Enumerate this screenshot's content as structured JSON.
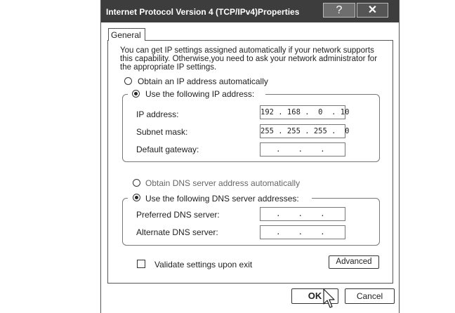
{
  "window": {
    "title": "Internet Protocol Version 4 (TCP/IPv4)Properties",
    "help_label": "?",
    "close_label": "✕"
  },
  "tab_general": "General",
  "intro_lines": [
    "You can get IP settings assigned automatically if your network supports",
    "this capability. Otherwise,you need to ask your network administrator for",
    "the appropriate IP settings."
  ],
  "ip_mode": {
    "auto_label": "Obtain an IP address automatically",
    "manual_label": "Use the following IP address:",
    "selected": "manual"
  },
  "ip_fields": {
    "ip_label": "IP address:",
    "ip_value": "192 . 168 .  0  . 10",
    "mask_label": "Subnet mask:",
    "mask_value": "255 . 255 . 255 .  0",
    "gateway_label": "Default gateway:",
    "gateway_value": "  .    .    .   "
  },
  "dns_mode": {
    "auto_label": "Obtain DNS  server address automatically",
    "manual_label": "Use the following DNS server addresses:",
    "selected": "manual"
  },
  "dns_fields": {
    "preferred_label": "Preferred DNS server:",
    "preferred_value": "  .    .    .   ",
    "alternate_label": "Alternate DNS server:",
    "alternate_value": "  .    .    .   "
  },
  "validate": {
    "label": "Validate settings upon exit",
    "checked": false
  },
  "buttons": {
    "advanced": "Advanced",
    "ok": "OK",
    "cancel": "Cancel"
  }
}
